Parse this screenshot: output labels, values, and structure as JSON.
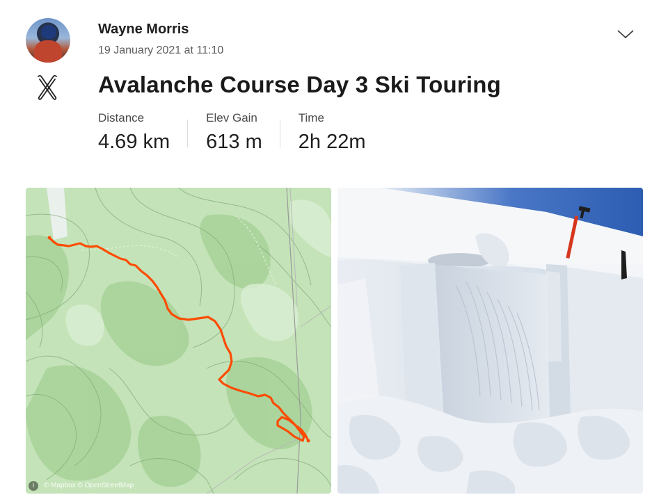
{
  "header": {
    "athlete_name": "Wayne Morris",
    "date": "19 January 2021 at 11:10",
    "menu_icon": "chevron-down-icon"
  },
  "activity": {
    "sport_icon": "ski-touring-icon",
    "title": "Avalanche Course Day 3 Ski Touring",
    "stats": [
      {
        "label": "Distance",
        "value": "4.69 km"
      },
      {
        "label": "Elev Gain",
        "value": "613 m"
      },
      {
        "label": "Time",
        "value": "2h 22m"
      }
    ]
  },
  "media": {
    "map": {
      "attribution": "© Mapbox © OpenStreetMap",
      "route_color": "#fc4c02",
      "map_color": "#b9dcae"
    },
    "photo": {
      "subject": "snow-pit-photo"
    }
  },
  "colors": {
    "accent": "#fc4c02",
    "text_primary": "#1f1f1f",
    "text_secondary": "#5c5c5c"
  }
}
